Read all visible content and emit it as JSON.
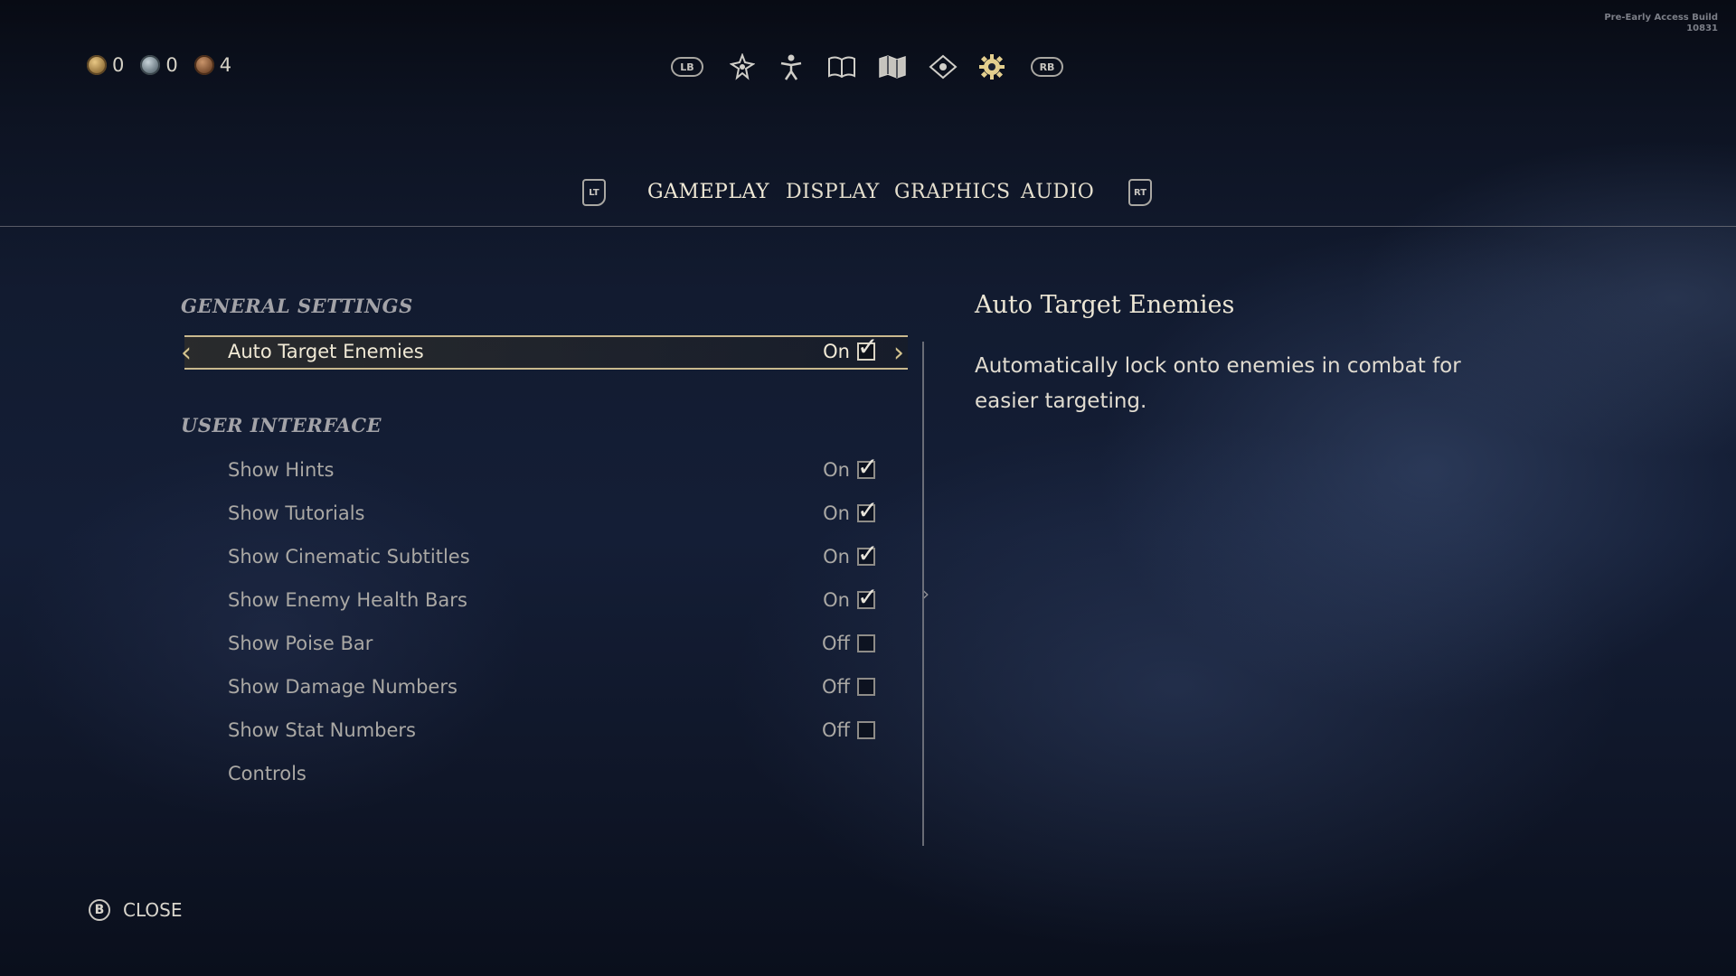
{
  "build_info": {
    "line1": "Pre-Early Access Build",
    "line2": "10831"
  },
  "currency": [
    {
      "icon": "gold-coin-icon",
      "count": "0"
    },
    {
      "icon": "silver-coin-icon",
      "count": "0"
    },
    {
      "icon": "bronze-coin-icon",
      "count": "4"
    }
  ],
  "top_nav": {
    "lb": "LB",
    "rb": "RB",
    "icons": [
      "skills-icon",
      "character-icon",
      "journal-icon",
      "map-icon",
      "objectives-icon",
      "settings-gear-icon"
    ]
  },
  "tabs": {
    "lt": "LT",
    "rt": "RT",
    "items": [
      "GAMEPLAY",
      "DISPLAY",
      "GRAPHICS",
      "AUDIO"
    ],
    "active": "GAMEPLAY"
  },
  "sections": {
    "general": "GENERAL SETTINGS",
    "ui": "USER INTERFACE"
  },
  "settings": {
    "auto_target": {
      "label": "Auto Target Enemies",
      "value": "On",
      "checked": true
    },
    "show_hints": {
      "label": "Show Hints",
      "value": "On",
      "checked": true
    },
    "show_tutorials": {
      "label": "Show Tutorials",
      "value": "On",
      "checked": true
    },
    "show_subtitles": {
      "label": "Show Cinematic Subtitles",
      "value": "On",
      "checked": true
    },
    "show_health": {
      "label": "Show Enemy Health Bars",
      "value": "On",
      "checked": true
    },
    "show_poise": {
      "label": "Show Poise Bar",
      "value": "Off",
      "checked": false
    },
    "show_damage": {
      "label": "Show Damage Numbers",
      "value": "Off",
      "checked": false
    },
    "show_stats": {
      "label": "Show Stat Numbers",
      "value": "Off",
      "checked": false
    },
    "controls": {
      "label": "Controls"
    }
  },
  "description": {
    "title": "Auto Target Enemies",
    "body": "Automatically lock onto enemies in combat for easier targeting."
  },
  "footer": {
    "button": "B",
    "close_label": "CLOSE"
  },
  "tick_glyph": "✓"
}
